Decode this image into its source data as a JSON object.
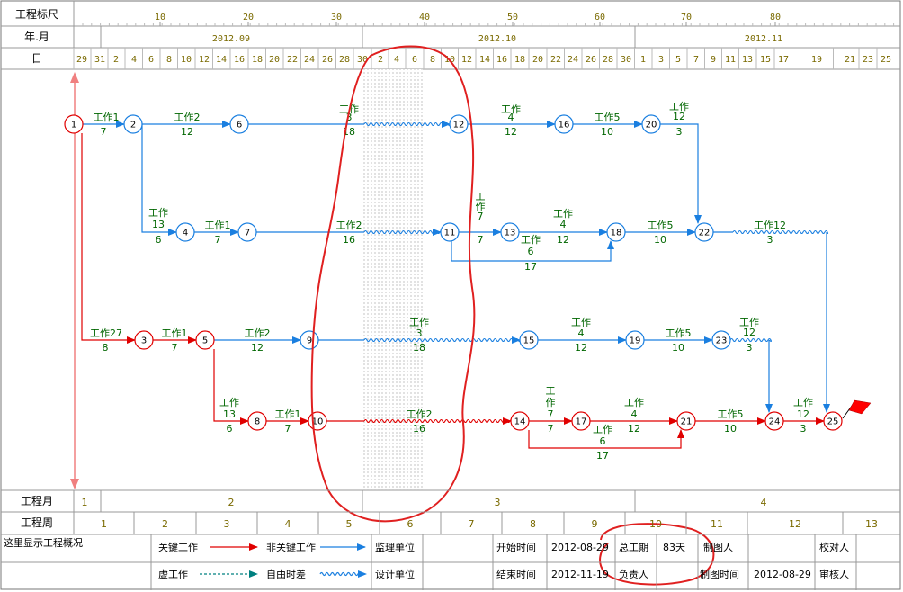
{
  "header": {
    "scale_label": "工程标尺",
    "month_label": "年.月",
    "day_label": "日",
    "scale_ticks": [
      "10",
      "20",
      "30",
      "40",
      "50",
      "60",
      "70",
      "80"
    ],
    "months": [
      "2012.09",
      "2012.10",
      "2012.11"
    ],
    "days": [
      "29",
      "31",
      "2",
      "4",
      "6",
      "8",
      "10",
      "12",
      "14",
      "16",
      "18",
      "20",
      "22",
      "24",
      "26",
      "28",
      "30",
      "2",
      "4",
      "6",
      "8",
      "10",
      "12",
      "14",
      "16",
      "18",
      "20",
      "22",
      "24",
      "26",
      "28",
      "30",
      "1",
      "3",
      "5",
      "7",
      "9",
      "11",
      "13",
      "15",
      "17",
      "19",
      "21",
      "23",
      "25"
    ]
  },
  "footer_rows": {
    "month_row_label": "工程月",
    "months": [
      "1",
      "2",
      "3",
      "4"
    ],
    "week_row_label": "工程周",
    "weeks": [
      "1",
      "2",
      "3",
      "4",
      "5",
      "6",
      "7",
      "8",
      "9",
      "10",
      "11",
      "12",
      "13"
    ]
  },
  "info": {
    "overview": "这里显示工程概况",
    "legend": {
      "critical": "关键工作",
      "noncritical": "非关键工作",
      "virtual": "虚工作",
      "free_float": "自由时差"
    },
    "supervisor_label": "监理单位",
    "designer_label": "设计单位",
    "start_label": "开始时间",
    "start_value": "2012-08-29",
    "end_label": "结束时间",
    "end_value": "2012-11-19",
    "duration_label": "总工期",
    "duration_value": "83天",
    "manager_label": "负责人",
    "drafter_label": "制图人",
    "draw_time_label": "制图时间",
    "draw_time_value": "2012-08-29",
    "checker_label": "校对人",
    "reviewer_label": "审核人"
  },
  "colors": {
    "critical": "#e00000",
    "noncritical": "#1a7fe0",
    "label_green": "#006600",
    "tick_olive": "#7a6a00",
    "annotation": "#e00000",
    "flag": "#ff0000"
  },
  "network": {
    "nodes": [
      {
        "id": "1",
        "critical": true
      },
      {
        "id": "2",
        "critical": false
      },
      {
        "id": "3",
        "critical": true
      },
      {
        "id": "4",
        "critical": false
      },
      {
        "id": "5",
        "critical": true
      },
      {
        "id": "6",
        "critical": false
      },
      {
        "id": "7",
        "critical": false
      },
      {
        "id": "8",
        "critical": true
      },
      {
        "id": "9",
        "critical": false
      },
      {
        "id": "10",
        "critical": true
      },
      {
        "id": "11",
        "critical": false
      },
      {
        "id": "12",
        "critical": false
      },
      {
        "id": "13",
        "critical": false
      },
      {
        "id": "14",
        "critical": true
      },
      {
        "id": "15",
        "critical": false
      },
      {
        "id": "16",
        "critical": false
      },
      {
        "id": "17",
        "critical": true
      },
      {
        "id": "18",
        "critical": false
      },
      {
        "id": "19",
        "critical": false
      },
      {
        "id": "20",
        "critical": false
      },
      {
        "id": "21",
        "critical": true
      },
      {
        "id": "22",
        "critical": false
      },
      {
        "id": "23",
        "critical": false
      },
      {
        "id": "24",
        "critical": true
      },
      {
        "id": "25",
        "critical": true
      }
    ],
    "activities": [
      {
        "from": "1",
        "to": "2",
        "name": "工作1",
        "duration": "7"
      },
      {
        "from": "2",
        "to": "6",
        "name": "工作2",
        "duration": "12"
      },
      {
        "from": "6",
        "to": "12",
        "name": "工作3",
        "duration": "18"
      },
      {
        "from": "12",
        "to": "16",
        "name": "工作4",
        "duration": "12"
      },
      {
        "from": "16",
        "to": "20",
        "name": "工作5",
        "duration": "10"
      },
      {
        "from": "20",
        "to": "22",
        "name": "工作12",
        "duration": "3"
      },
      {
        "from": "2",
        "to": "4",
        "name": "工作13",
        "duration": "6"
      },
      {
        "from": "4",
        "to": "7",
        "name": "工作1",
        "duration": "7"
      },
      {
        "from": "7",
        "to": "11",
        "name": "工作2",
        "duration": "16"
      },
      {
        "from": "11",
        "to": "13",
        "name": "工作7",
        "duration": "7"
      },
      {
        "from": "13",
        "to": "18",
        "name": "工作4",
        "duration": "12"
      },
      {
        "from": "11",
        "to": "18",
        "name": "工作6",
        "duration": "17"
      },
      {
        "from": "18",
        "to": "22",
        "name": "工作5",
        "duration": "10"
      },
      {
        "from": "22",
        "to": "25",
        "name": "工作12",
        "duration": "3"
      },
      {
        "from": "1",
        "to": "3",
        "name": "工作27",
        "duration": "8"
      },
      {
        "from": "3",
        "to": "5",
        "name": "工作1",
        "duration": "7"
      },
      {
        "from": "5",
        "to": "9",
        "name": "工作2",
        "duration": "12"
      },
      {
        "from": "9",
        "to": "15",
        "name": "工作3",
        "duration": "18"
      },
      {
        "from": "15",
        "to": "19",
        "name": "工作4",
        "duration": "12"
      },
      {
        "from": "19",
        "to": "23",
        "name": "工作5",
        "duration": "10"
      },
      {
        "from": "23",
        "to": "24",
        "name": "工作12",
        "duration": "3"
      },
      {
        "from": "5",
        "to": "8",
        "name": "工作13",
        "duration": "6"
      },
      {
        "from": "8",
        "to": "10",
        "name": "工作1",
        "duration": "7"
      },
      {
        "from": "10",
        "to": "14",
        "name": "工作2",
        "duration": "16"
      },
      {
        "from": "14",
        "to": "17",
        "name": "工作7",
        "duration": "7"
      },
      {
        "from": "17",
        "to": "21",
        "name": "工作4",
        "duration": "12"
      },
      {
        "from": "14",
        "to": "21",
        "name": "工作6",
        "duration": "17"
      },
      {
        "from": "21",
        "to": "24",
        "name": "工作5",
        "duration": "10"
      },
      {
        "from": "24",
        "to": "25",
        "name": "工作12",
        "duration": "3"
      }
    ]
  }
}
